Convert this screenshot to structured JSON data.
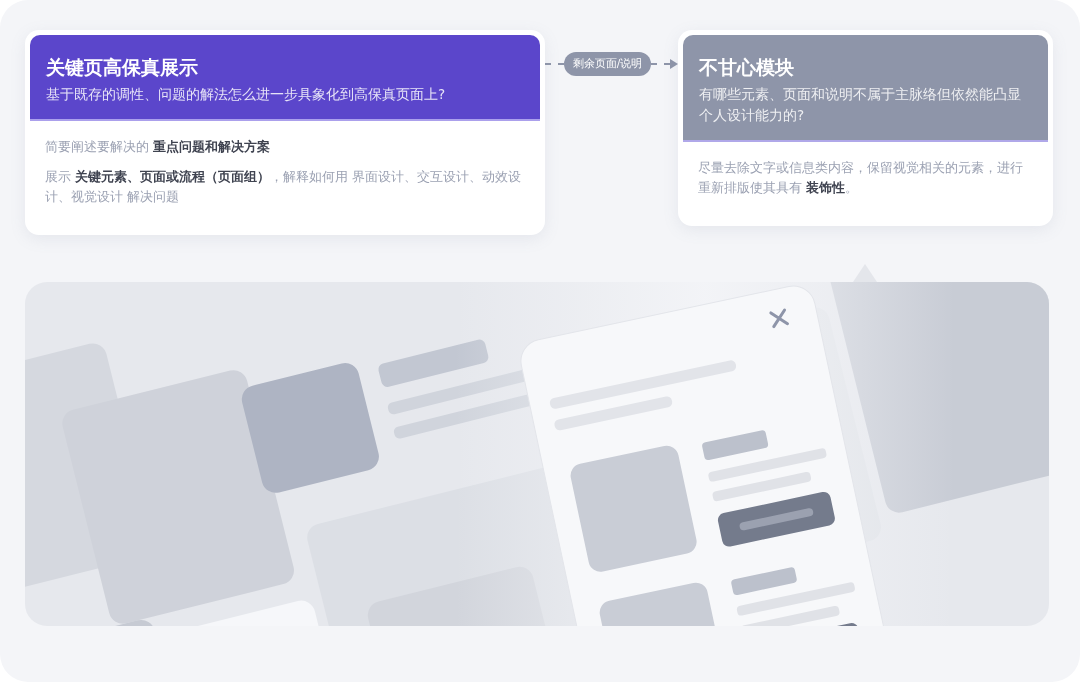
{
  "cards": [
    {
      "title": "关键页高保真展示",
      "subtitle": "基于既存的调性、问题的解法怎么进一步具象化到高保真页面上?",
      "color": "#5b46cb",
      "paragraphs": [
        "简要阐述要解决的 **重点问题和解决方案**",
        "展示 **关键元素、页面或流程（页面组）**，解释如何用 界面设计、交互设计、动效设计、视觉设计 解决问题"
      ]
    },
    {
      "title": "不甘心模块",
      "subtitle": "有哪些元素、页面和说明不属于主脉络但依然能凸显个人设计能力的?",
      "color": "#8e95a9",
      "paragraphs": [
        "尽量去除文字或信息类内容，保留视觉相关的元素，进行重新排版使其具有 **装饰性**。"
      ]
    }
  ],
  "connector": {
    "label": "剩余页面/说明"
  }
}
